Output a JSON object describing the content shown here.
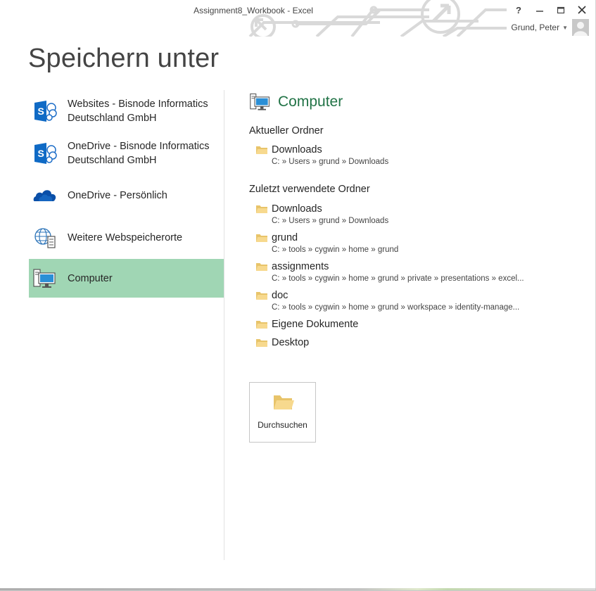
{
  "window": {
    "title": "Assignment8_Workbook - Excel",
    "controls": {
      "help": "?",
      "minimize": "—",
      "restore": "□",
      "close": "✕"
    },
    "user": {
      "name": "Grund, Peter"
    }
  },
  "page": {
    "title": "Speichern unter"
  },
  "colors": {
    "accent": "#217346",
    "selected": "#a0d6b4"
  },
  "nav": {
    "items": [
      {
        "label": "Websites - Bisnode Informatics Deutschland GmbH",
        "icon": "sharepoint-icon",
        "selected": false
      },
      {
        "label": "OneDrive - Bisnode Informatics Deutschland GmbH",
        "icon": "sharepoint-icon",
        "selected": false
      },
      {
        "label": "OneDrive - Persönlich",
        "icon": "onedrive-cloud-icon",
        "selected": false
      },
      {
        "label": "Weitere Webspeicherorte",
        "icon": "web-location-icon",
        "selected": false
      },
      {
        "label": "Computer",
        "icon": "computer-icon",
        "selected": true
      }
    ]
  },
  "panel": {
    "title": "Computer",
    "current_label": "Aktueller Ordner",
    "current": {
      "name": "Downloads",
      "path": "C: » Users » grund » Downloads"
    },
    "recent_label": "Zuletzt verwendete Ordner",
    "recent": [
      {
        "name": "Downloads",
        "path": "C: » Users » grund » Downloads"
      },
      {
        "name": "grund",
        "path": "C: » tools » cygwin » home » grund"
      },
      {
        "name": "assignments",
        "path": "C: » tools » cygwin » home » grund » private » presentations » excel..."
      },
      {
        "name": "doc",
        "path": "C: » tools » cygwin » home » grund » workspace » identity-manage..."
      },
      {
        "name": "Eigene Dokumente",
        "path": ""
      },
      {
        "name": "Desktop",
        "path": ""
      }
    ],
    "browse_label": "Durchsuchen"
  }
}
